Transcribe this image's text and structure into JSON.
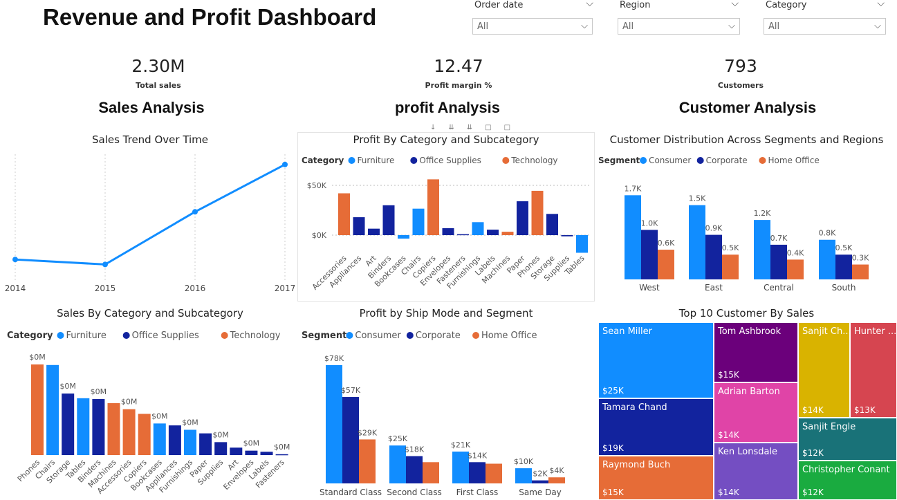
{
  "header": {
    "title": "Revenue and Profit Dashboard"
  },
  "slicers": [
    {
      "label": "Order date",
      "value": "All"
    },
    {
      "label": "Region",
      "value": "All"
    },
    {
      "label": "Category",
      "value": "All"
    }
  ],
  "kpis": [
    {
      "value": "2.30M",
      "label": "Total sales"
    },
    {
      "value": "12.47",
      "label": "Profit margin %"
    },
    {
      "value": "793",
      "label": "Customers"
    }
  ],
  "sections": [
    "Sales Analysis",
    "profit Analysis",
    "Customer Analysis"
  ],
  "colors": {
    "furniture": "#118DFF",
    "office_supplies": "#12239E",
    "technology": "#E66C37",
    "consumer": "#118DFF",
    "corporate": "#12239E",
    "home_office": "#E66C37"
  },
  "chart_data": [
    {
      "id": "sales_trend",
      "type": "line",
      "title": "Sales Trend Over Time",
      "x": [
        "2014",
        "2015",
        "2016",
        "2017"
      ],
      "series": [
        {
          "values": [
            484000,
            471000,
            609000,
            733000
          ]
        }
      ],
      "ylim": [
        430000,
        760000
      ],
      "grid": "vertical"
    },
    {
      "id": "profit_by_subcat",
      "type": "bar",
      "title": "Profit By Category and Subcategory",
      "legend_title": "Category",
      "legend": [
        "Furniture",
        "Office Supplies",
        "Technology"
      ],
      "categories": [
        "Accessories",
        "Appliances",
        "Art",
        "Binders",
        "Bookcases",
        "Chairs",
        "Copiers",
        "Envelopes",
        "Fasteners",
        "Furnishings",
        "Labels",
        "Machines",
        "Paper",
        "Phones",
        "Storage",
        "Supplies",
        "Tables"
      ],
      "values": [
        42000,
        18000,
        6500,
        30000,
        -3500,
        26600,
        56000,
        7000,
        950,
        13000,
        5500,
        3400,
        34000,
        44500,
        21300,
        -1200,
        -17700
      ],
      "category_group": [
        "Technology",
        "Office Supplies",
        "Office Supplies",
        "Office Supplies",
        "Furniture",
        "Furniture",
        "Technology",
        "Office Supplies",
        "Office Supplies",
        "Furniture",
        "Office Supplies",
        "Technology",
        "Office Supplies",
        "Technology",
        "Office Supplies",
        "Office Supplies",
        "Furniture"
      ],
      "yticks": [
        "$0K",
        "$50K"
      ],
      "ylim": [
        -22000,
        60000
      ]
    },
    {
      "id": "customer_distribution",
      "type": "bar",
      "title": "Customer Distribution Across Segments and Regions",
      "legend_title": "Segment",
      "categories": [
        "West",
        "East",
        "Central",
        "South"
      ],
      "series": [
        {
          "name": "Consumer",
          "values": [
            1.7,
            1.5,
            1.2,
            0.8
          ],
          "labels": [
            "1.7K",
            "1.5K",
            "1.2K",
            "0.8K"
          ]
        },
        {
          "name": "Corporate",
          "values": [
            1.0,
            0.9,
            0.7,
            0.5
          ],
          "labels": [
            "1.0K",
            "0.9K",
            "0.7K",
            "0.5K"
          ]
        },
        {
          "name": "Home Office",
          "values": [
            0.6,
            0.5,
            0.4,
            0.3
          ],
          "labels": [
            "0.6K",
            "0.5K",
            "0.4K",
            "0.3K"
          ]
        }
      ],
      "ylim": [
        0,
        1.9
      ]
    },
    {
      "id": "sales_by_subcat",
      "type": "bar",
      "title": "Sales By Category and Subcategory",
      "legend_title": "Category",
      "legend": [
        "Furniture",
        "Office Supplies",
        "Technology"
      ],
      "categories": [
        "Phones",
        "Chairs",
        "Storage",
        "Tables",
        "Binders",
        "Machines",
        "Accessories",
        "Copiers",
        "Bookcases",
        "Appliances",
        "Furnishings",
        "Paper",
        "Supplies",
        "Art",
        "Envelopes",
        "Labels",
        "Fasteners"
      ],
      "values": [
        330000,
        328000,
        224000,
        207000,
        204000,
        189000,
        167000,
        150000,
        115000,
        108000,
        92000,
        79000,
        47000,
        27000,
        16000,
        12000,
        3000
      ],
      "category_group": [
        "Technology",
        "Furniture",
        "Office Supplies",
        "Furniture",
        "Office Supplies",
        "Technology",
        "Technology",
        "Technology",
        "Furniture",
        "Office Supplies",
        "Furniture",
        "Office Supplies",
        "Office Supplies",
        "Office Supplies",
        "Office Supplies",
        "Office Supplies",
        "Office Supplies"
      ],
      "data_labels": [
        "$0M",
        "",
        "$0M",
        "",
        "$0M",
        "",
        "$0M",
        "",
        "$0M",
        "",
        "$0M",
        "",
        "$0M",
        "",
        "$0M",
        "",
        "$0M"
      ],
      "ylim": [
        0,
        350000
      ]
    },
    {
      "id": "profit_ship_mode",
      "type": "bar",
      "title": "Profit by Ship Mode and Segment",
      "legend_title": "Segment",
      "categories": [
        "Standard Class",
        "Second Class",
        "First Class",
        "Same Day"
      ],
      "series": [
        {
          "name": "Consumer",
          "values": [
            78,
            25,
            21,
            10
          ],
          "labels": [
            "$78K",
            "$25K",
            "$21K",
            "$10K"
          ]
        },
        {
          "name": "Corporate",
          "values": [
            57,
            18,
            14,
            2
          ],
          "labels": [
            "$57K",
            "$18K",
            "$14K",
            "$2K"
          ]
        },
        {
          "name": "Home Office",
          "values": [
            29,
            14,
            13,
            4
          ],
          "labels": [
            "$29K",
            "",
            "",
            "$4K"
          ]
        }
      ],
      "ylim": [
        0,
        85
      ]
    }
  ],
  "treemap": {
    "title": "Top 10 Customer By Sales",
    "items": [
      {
        "name": "Sean Miller",
        "value": "$25K",
        "color": "#118DFF"
      },
      {
        "name": "Tamara Chand",
        "value": "$19K",
        "color": "#12239E"
      },
      {
        "name": "Raymond Buch",
        "value": "$15K",
        "color": "#E66C37"
      },
      {
        "name": "Tom Ashbrook",
        "value": "$15K",
        "color": "#6B007B"
      },
      {
        "name": "Adrian Barton",
        "value": "$14K",
        "color": "#E044A7"
      },
      {
        "name": "Ken Lonsdale",
        "value": "$14K",
        "color": "#744EC2"
      },
      {
        "name": "Sanjit Ch...",
        "value": "$14K",
        "color": "#D9B300"
      },
      {
        "name": "Hunter ...",
        "value": "$13K",
        "color": "#D64550"
      },
      {
        "name": "Sanjit Engle",
        "value": "$12K",
        "color": "#197278"
      },
      {
        "name": "Christopher Conant",
        "value": "$12K",
        "color": "#1AAB40"
      }
    ]
  }
}
